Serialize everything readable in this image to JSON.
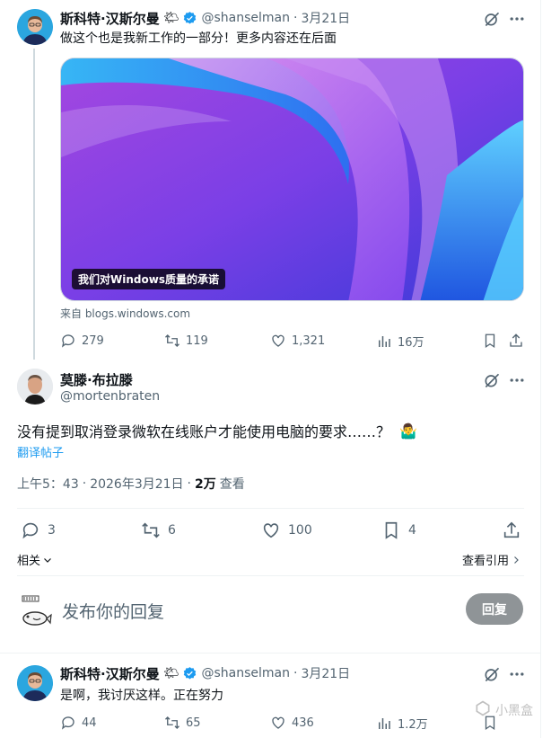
{
  "tweet1": {
    "display_name": "斯科特·汉斯尔曼",
    "handle": "@shanselman",
    "date": "3月21日",
    "separator": "·",
    "text": "做这个也是我新工作的一部分！更多内容还在后面",
    "card_caption": "我们对Windows质量的承诺",
    "card_source": "来自 blogs.windows.com",
    "replies": "279",
    "retweets": "119",
    "likes": "1,321",
    "views": "16万"
  },
  "main_tweet": {
    "display_name": "莫滕·布拉滕",
    "handle": "@mortenbraten",
    "text": "没有提到取消登录微软在线账户才能使用电脑的要求……？",
    "emoji": "🤷‍♂️",
    "translate": "翻译帖子",
    "time": "上午5：43",
    "date": "2026年3月21日",
    "dot": "·",
    "views_count": "2万",
    "views_label": "查看",
    "replies": "3",
    "retweets": "6",
    "likes": "100",
    "bookmarks": "4",
    "related": "相关",
    "view_quotes": "查看引用"
  },
  "composer": {
    "placeholder": "发布你的回复",
    "button": "回复"
  },
  "tweet2": {
    "display_name": "斯科特·汉斯尔曼",
    "handle": "@shanselman",
    "date": "3月21日",
    "separator": "·",
    "text": "是啊，我讨厌这样。正在努力",
    "replies": "44",
    "retweets": "65",
    "likes": "436",
    "views": "1.2万"
  },
  "watermark": "小黑盒",
  "colors": {
    "verified": "#1d9bf0",
    "link": "#1d9bf0",
    "muted": "#536471",
    "button_disabled": "#8f9497"
  }
}
